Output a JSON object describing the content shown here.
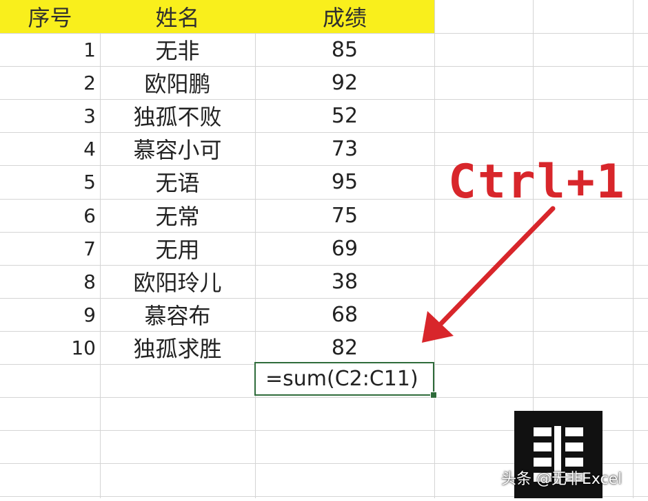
{
  "sheet": {
    "headers": {
      "index": "序号",
      "name": "姓名",
      "score": "成绩"
    },
    "rows": [
      {
        "index": "1",
        "name": "无非",
        "score": "85"
      },
      {
        "index": "2",
        "name": "欧阳鹏",
        "score": "92"
      },
      {
        "index": "3",
        "name": "独孤不败",
        "score": "52"
      },
      {
        "index": "4",
        "name": "慕容小可",
        "score": "73"
      },
      {
        "index": "5",
        "name": "无语",
        "score": "95"
      },
      {
        "index": "6",
        "name": "无常",
        "score": "75"
      },
      {
        "index": "7",
        "name": "无用",
        "score": "69"
      },
      {
        "index": "8",
        "name": "欧阳玲儿",
        "score": "38"
      },
      {
        "index": "9",
        "name": "慕容布",
        "score": "68"
      },
      {
        "index": "10",
        "name": "独孤求胜",
        "score": "82"
      }
    ],
    "formula_cell": "=sum(C2:C11)"
  },
  "annotation": {
    "shortcut": "Ctrl+1"
  },
  "watermark": {
    "text": "头条 @无非Excel"
  },
  "colors": {
    "header_fill": "#f9ef1c",
    "arrow": "#d8262b",
    "active_border": "#2e6b3a",
    "gridline": "#d4d4d4"
  },
  "icons": {
    "logo": "brand-logo-icon",
    "arrow": "red-arrow-icon"
  }
}
